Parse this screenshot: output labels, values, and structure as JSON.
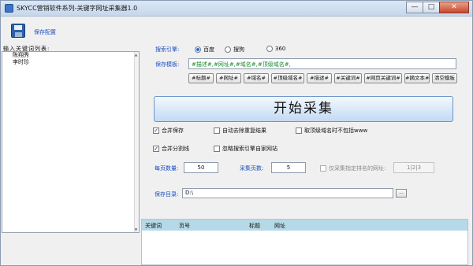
{
  "window": {
    "title": "SKYCC营销软件系列-关键字网址采集器1.0",
    "controls": [
      "—",
      "□",
      "✕"
    ]
  },
  "toolbar": {
    "save_label": "保存配置"
  },
  "keywords": {
    "label": "输入关键词列表:",
    "items": [
      "陈翔秀",
      "李时珍"
    ]
  },
  "engine": {
    "label": "搜索引擎:",
    "options": [
      {
        "label": "百度",
        "selected": true
      },
      {
        "label": "搜狗",
        "selected": false
      },
      {
        "label": "360",
        "selected": false
      }
    ]
  },
  "template": {
    "label": "保存模板:",
    "value": "#描述#,#网址#,#域名#,#顶级域名#,",
    "tags": [
      "#标题#",
      "#网址#",
      "#域名#",
      "#顶级域名#",
      "#描述#",
      "#关键词#",
      "#网页关键词#",
      "#摘文本#",
      "清空模板"
    ]
  },
  "start_label": "开始采集",
  "options": {
    "merge_save": {
      "label": "合并保存",
      "checked": true
    },
    "auto_dedup": {
      "label": "自动去除重复结果",
      "checked": false
    },
    "no_www": {
      "label": "取顶级域名时不包括www",
      "checked": false
    },
    "merge_split": {
      "label": "合并分割线",
      "checked": true
    },
    "ignore_own": {
      "label": "忽略搜索引擎自家网站",
      "checked": false
    }
  },
  "per_page": {
    "label": "每页数量:",
    "value": "50"
  },
  "pages": {
    "label": "采集页数:",
    "value": "5"
  },
  "rank": {
    "label": "仅采集指定排名的网址:",
    "value": "1|2|3",
    "checked": false
  },
  "save_dir": {
    "label": "保存目录:",
    "value": "D:\\",
    "browse": "..."
  },
  "results": {
    "columns": [
      "关键词",
      "页号",
      "标题",
      "网址"
    ]
  }
}
